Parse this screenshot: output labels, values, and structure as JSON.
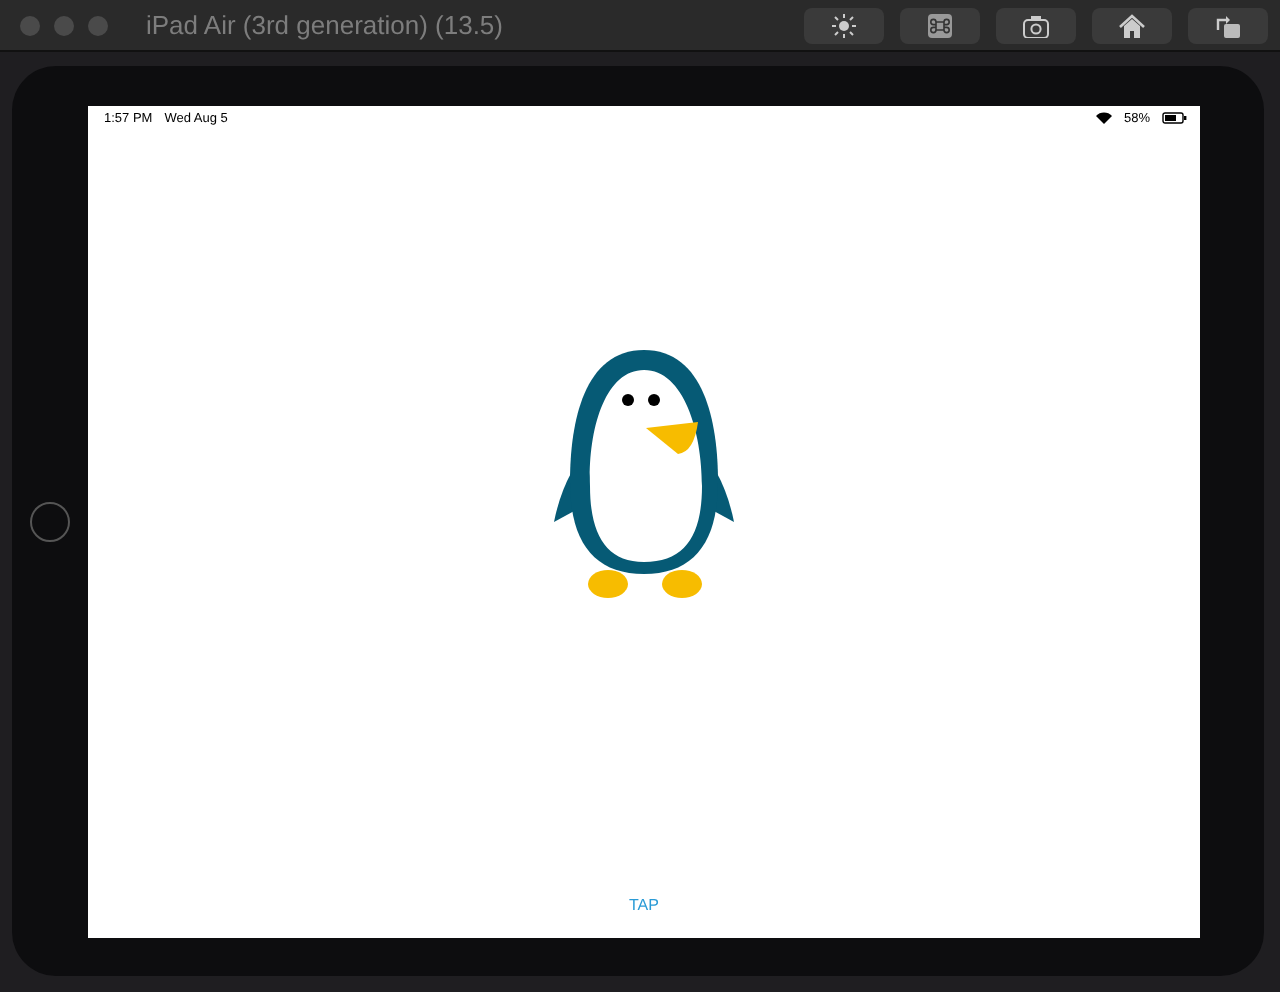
{
  "window": {
    "title": "iPad Air (3rd generation) (13.5)"
  },
  "status_bar": {
    "time": "1:57 PM",
    "date": "Wed Aug 5",
    "battery_text": "58%"
  },
  "screen": {
    "button": "TAP"
  }
}
